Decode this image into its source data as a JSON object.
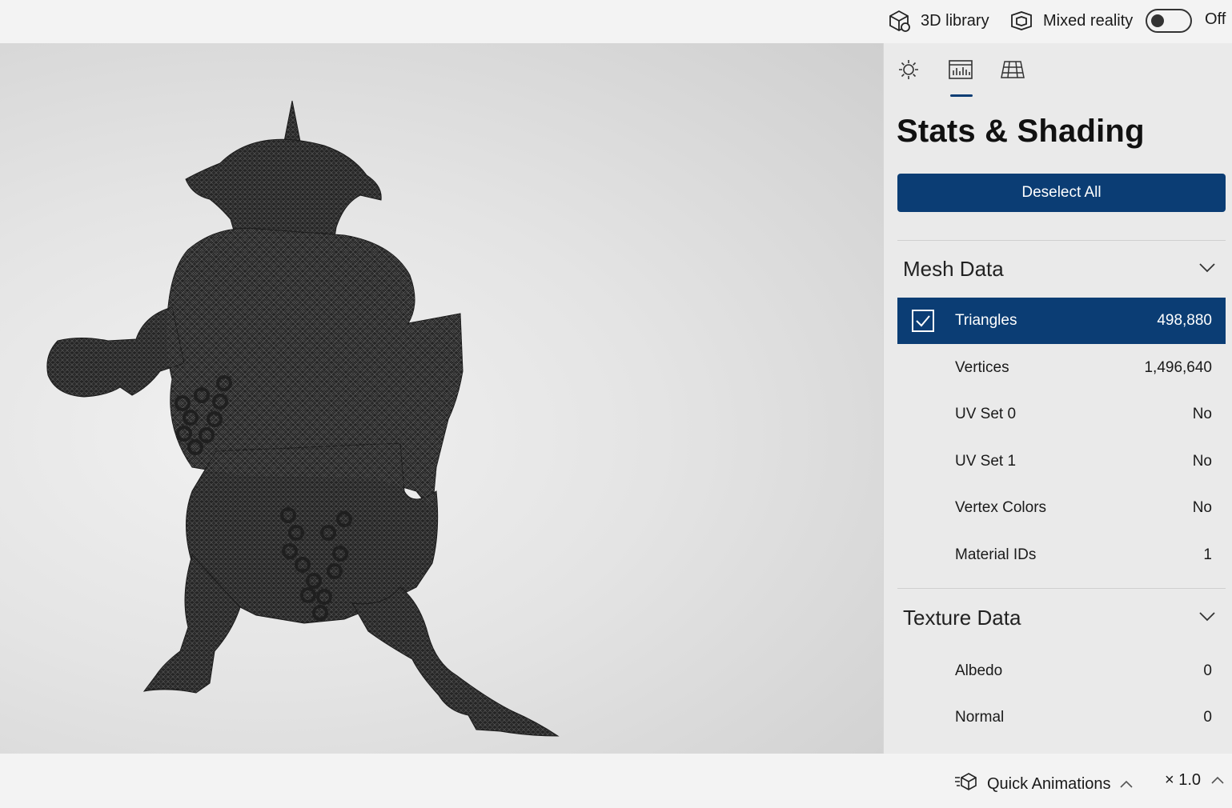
{
  "topbar": {
    "library_label": "3D library",
    "mixed_reality_label": "Mixed reality",
    "mixed_reality_state": "Off",
    "mixed_reality_on": false
  },
  "panel": {
    "tabs": [
      {
        "icon": "sun-icon",
        "selected": false
      },
      {
        "icon": "stats-icon",
        "selected": true
      },
      {
        "icon": "grid-icon",
        "selected": false
      }
    ],
    "title": "Stats & Shading",
    "deselect_label": "Deselect All",
    "mesh_section": {
      "label": "Mesh Data",
      "rows": [
        {
          "name": "Triangles",
          "value": "498,880",
          "checked": true
        },
        {
          "name": "Vertices",
          "value": "1,496,640"
        },
        {
          "name": "UV Set 0",
          "value": "No"
        },
        {
          "name": "UV Set 1",
          "value": "No"
        },
        {
          "name": "Vertex Colors",
          "value": "No"
        },
        {
          "name": "Material IDs",
          "value": "1"
        }
      ]
    },
    "texture_section": {
      "label": "Texture Data",
      "rows": [
        {
          "name": "Albedo",
          "value": "0"
        },
        {
          "name": "Normal",
          "value": "0"
        }
      ]
    }
  },
  "bottombar": {
    "animations_label": "Quick Animations",
    "speed_label": "× 1.0"
  },
  "colors": {
    "accent": "#0b3d74",
    "panel_bg": "#eaeaea",
    "chrome_bg": "#f3f3f3"
  }
}
